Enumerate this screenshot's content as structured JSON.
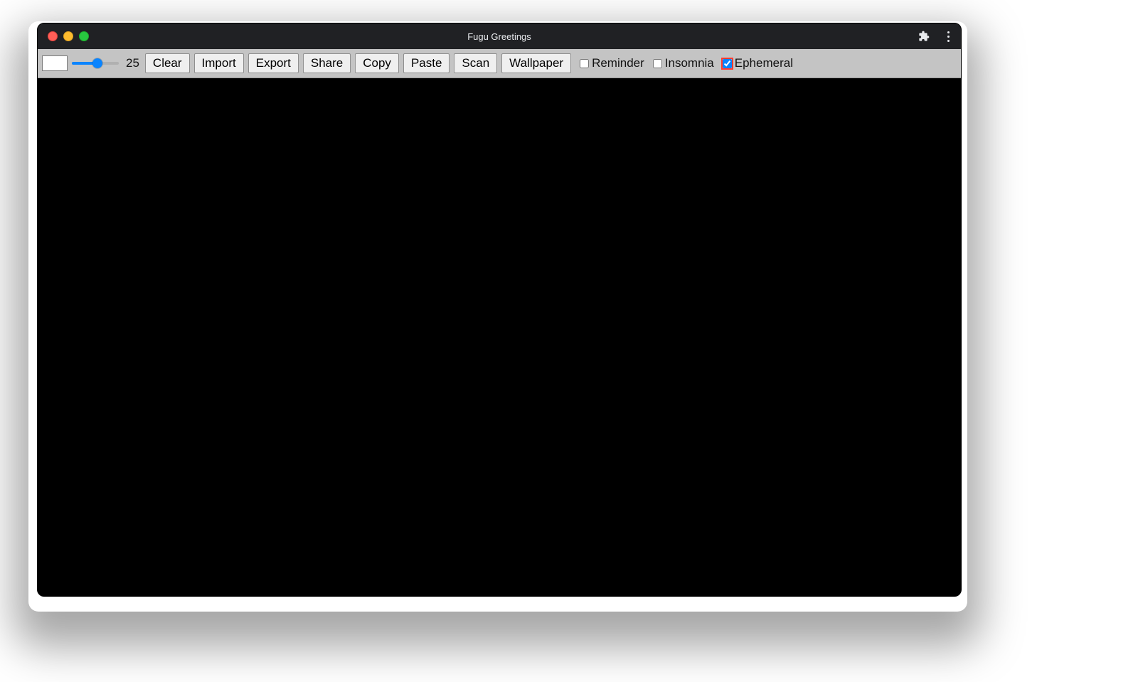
{
  "window": {
    "title": "Fugu Greetings"
  },
  "toolbar": {
    "slider_value": "25",
    "buttons": {
      "clear": "Clear",
      "import": "Import",
      "export": "Export",
      "share": "Share",
      "copy": "Copy",
      "paste": "Paste",
      "scan": "Scan",
      "wallpaper": "Wallpaper"
    },
    "checkboxes": {
      "reminder": {
        "label": "Reminder",
        "checked": false
      },
      "insomnia": {
        "label": "Insomnia",
        "checked": false
      },
      "ephemeral": {
        "label": "Ephemeral",
        "checked": true
      }
    }
  },
  "colors": {
    "accent": "#0a84ff",
    "focus_outline": "#ff3b30"
  }
}
